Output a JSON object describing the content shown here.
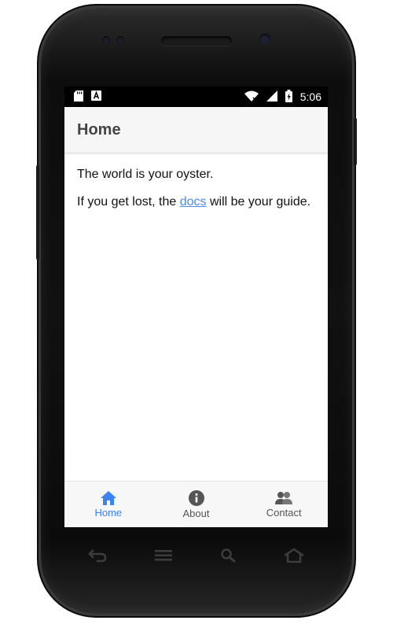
{
  "status_bar": {
    "left_icons": [
      "sd-card-icon",
      "notification-a-icon"
    ],
    "right_icons": [
      "wifi-icon",
      "signal-icon",
      "battery-charging-icon"
    ],
    "time": "5:06"
  },
  "header": {
    "title": "Home"
  },
  "content": {
    "line1": "The world is your oyster.",
    "line2_before": "If you get lost, the ",
    "line2_link": "docs",
    "line2_after": " will be your guide."
  },
  "tabs": [
    {
      "label": "Home",
      "icon": "home-icon",
      "active": true
    },
    {
      "label": "About",
      "icon": "info-icon",
      "active": false
    },
    {
      "label": "Contact",
      "icon": "contacts-icon",
      "active": false
    }
  ],
  "nav_buttons": [
    "back-icon",
    "menu-icon",
    "search-icon",
    "home-outline-icon"
  ],
  "colors": {
    "accent": "#3c82f0",
    "link": "#4a8bea",
    "header_bg": "#f6f6f6",
    "status_bar_bg": "#000000"
  }
}
